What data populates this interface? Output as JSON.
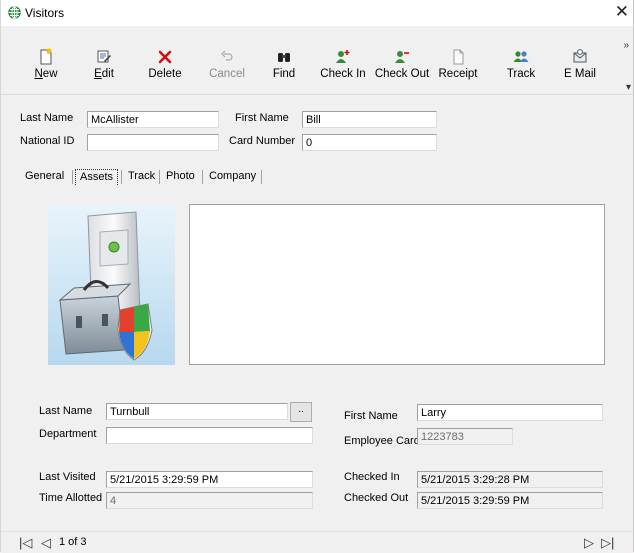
{
  "window": {
    "title": "Visitors"
  },
  "toolbar": {
    "buttons": [
      {
        "label": "New",
        "accel": "N",
        "rest": "ew",
        "icon": "new-icon"
      },
      {
        "label": "Edit",
        "accel": "E",
        "rest": "dit",
        "icon": "edit-icon"
      },
      {
        "label": "Delete",
        "icon": "delete-icon"
      },
      {
        "label": "Cancel",
        "icon": "cancel-icon"
      },
      {
        "label": "Find",
        "icon": "find-icon"
      },
      {
        "label": "Check In",
        "icon": "check-in-icon"
      },
      {
        "label": "Check Out",
        "icon": "check-out-icon"
      },
      {
        "label": "Receipt",
        "icon": "receipt-icon"
      },
      {
        "label": "Track",
        "icon": "track-icon"
      },
      {
        "label": "E Mail",
        "icon": "email-icon"
      }
    ]
  },
  "visitor": {
    "last_name_label": "Last Name",
    "last_name": "McAllister",
    "first_name_label": "First Name",
    "first_name": "Bill",
    "national_id_label": "National ID",
    "national_id": "",
    "card_number_label": "Card Number",
    "card_number": "0"
  },
  "tabs": [
    "General",
    "Assets",
    "Track",
    "Photo",
    "Company"
  ],
  "tabs_active": "Assets",
  "host": {
    "last_name_label": "Last Name",
    "last_name": "Turnbull",
    "lookup_label": "..",
    "department_label": "Department",
    "department": "",
    "first_name_label": "First Name",
    "first_name": "Larry",
    "employee_card_label": "Employee Card",
    "employee_card": "1223783",
    "last_visited_label": "Last Visited",
    "last_visited": "5/21/2015 3:29:59 PM",
    "time_allotted_label": "Time Allotted",
    "time_allotted": "4",
    "checked_in_label": "Checked In",
    "checked_in": "5/21/2015 3:29:28 PM",
    "checked_out_label": "Checked Out",
    "checked_out": "5/21/2015 3:29:59 PM"
  },
  "nav": {
    "record": "1 of 3"
  },
  "colors": {
    "delete_red": "#d01010",
    "track_green": "#2e8b2e"
  }
}
